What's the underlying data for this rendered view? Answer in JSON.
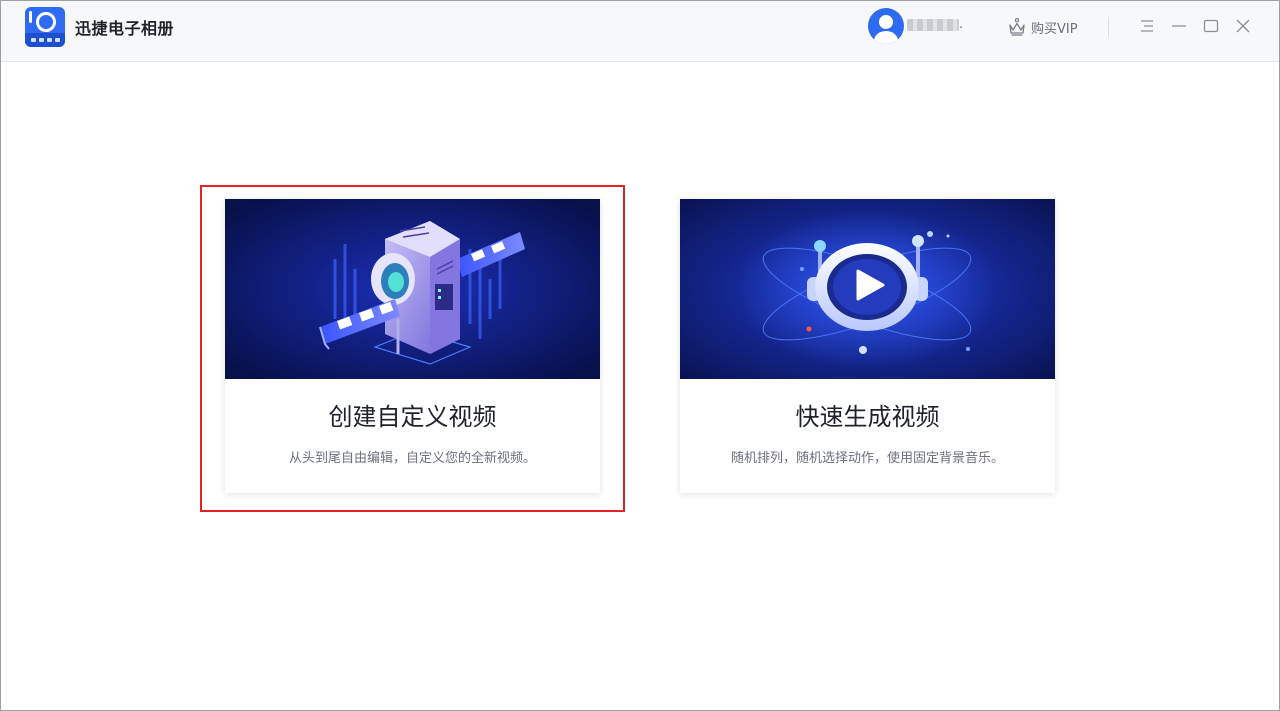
{
  "app": {
    "title": "迅捷电子相册"
  },
  "header": {
    "username_suffix": ".",
    "vip_label": "购买VIP"
  },
  "cards": [
    {
      "title": "创建自定义视频",
      "description": "从头到尾自由编辑，自定义您的全新视频。"
    },
    {
      "title": "快速生成视频",
      "description": "随机排列，随机选择动作，使用固定背景音乐。"
    }
  ],
  "colors": {
    "accent": "#2f6bf2",
    "highlight": "#e02424",
    "banner_dark": "#0a1352",
    "banner_glow": "#2a4ff5"
  },
  "icons": [
    "app-logo-icon",
    "user-avatar-icon",
    "crown-icon",
    "menu-icon",
    "minimize-icon",
    "maximize-icon",
    "close-icon",
    "film-machine-illustration",
    "play-button-illustration"
  ]
}
